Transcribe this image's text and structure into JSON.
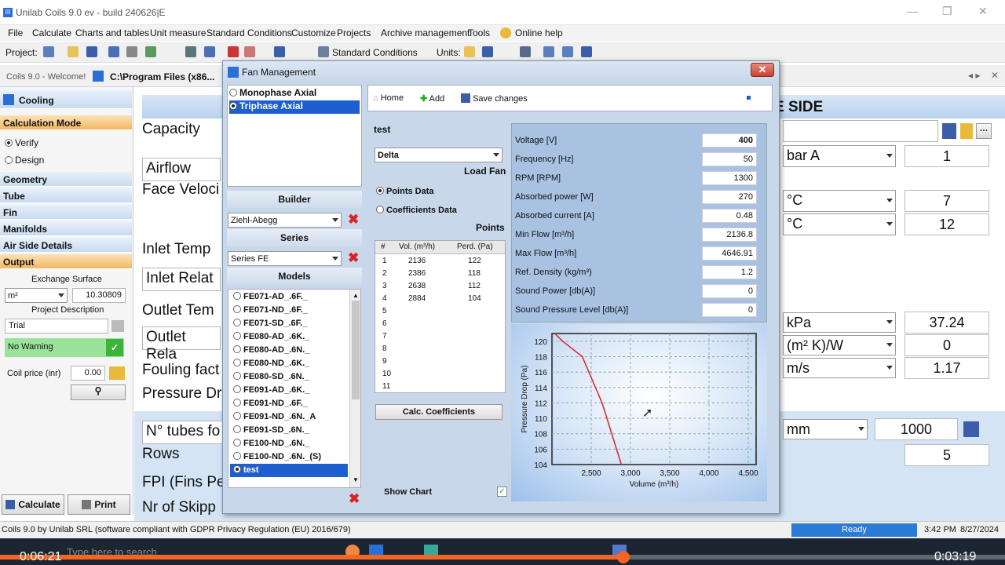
{
  "app": {
    "title": "Unilab Coils 9.0 ev - build 240626|E",
    "logo": "III"
  },
  "menu": [
    "File",
    "Calculate",
    "Charts and tables",
    "Unit measure",
    "Standard Conditions",
    "Customize",
    "Projects",
    "Archive management",
    "Tools",
    "Online help"
  ],
  "toolbar": {
    "project_label": "Project:",
    "std_cond": "Standard Conditions",
    "units_label": "Units:"
  },
  "tabs": {
    "welcome": "Coils 9.0 - Welcome!",
    "path": "C:\\Program Files (x86..."
  },
  "sidebar": {
    "cooling": "Cooling",
    "calc_mode": "Calculation Mode",
    "verify": "Verify",
    "design": "Design",
    "geometry": "Geometry",
    "tube": "Tube",
    "fin": "Fin",
    "manifolds": "Manifolds",
    "air_side": "Air Side Details",
    "output": "Output",
    "exchange_surface": "Exchange Surface",
    "unit": "m²",
    "surface_value": "10.30809",
    "project_desc": "Project Description",
    "trial": "Trial",
    "warning": "No Warning",
    "coil_price_label": "Coil price (inr)",
    "coil_price": "0.00",
    "calculate": "Calculate",
    "print": "Print"
  },
  "main": {
    "capacity": "Capacity",
    "airflow": "Airflow",
    "face_velocity": "Face Veloci",
    "inlet_temp": "Inlet Temp",
    "inlet_rel": "Inlet Relat",
    "outlet_temp": "Outlet Tem",
    "outlet_rel": "Outlet Rela",
    "fouling": "Fouling fact",
    "pressure_drop": "Pressure Dr",
    "n_tubes": "N° tubes fo",
    "rows": "Rows",
    "fpi": "FPI (Fins Pe",
    "nr_skipped": "Nr of Skipp",
    "side_title": "E SIDE"
  },
  "right": {
    "r1_unit": "bar A",
    "r1_val": "1",
    "r2_unit": "°C",
    "r2_val": "7",
    "r3_unit": "°C",
    "r3_val": "12",
    "r4_unit": "kPa",
    "r4_val": "37.24",
    "r5_unit": "(m² K)/W",
    "r5_val": "0",
    "r6_unit": "m/s",
    "r6_val": "1.17",
    "r7_unit": "mm",
    "r7_val": "1000",
    "r8_val": "5"
  },
  "dialog": {
    "title": "Fan Management",
    "types": [
      "Monophase Axial",
      "Triphase Axial"
    ],
    "builder_hdr": "Builder",
    "builder": "Ziehl-Abegg",
    "series_hdr": "Series",
    "series": "Series FE",
    "models_hdr": "Models",
    "models": [
      "FE071-AD_.6F._",
      "FE071-ND_.6F._",
      "FE071-SD_.6F._",
      "FE080-AD_.6K._",
      "FE080-AD_.6N._",
      "FE080-ND_.6K._",
      "FE080-SD_.6N._",
      "FE091-AD_.6K._",
      "FE091-ND_.6F._",
      "FE091-ND_.6N._A",
      "FE091-SD_.6N._",
      "FE100-ND_.6N._",
      "FE100-ND_.6N._(S)",
      "test"
    ],
    "home": "Home",
    "add": "Add",
    "save": "Save changes",
    "fan_name": "test",
    "connection": "Delta",
    "load_fan": "Load Fan",
    "points_data": "Points Data",
    "coeff_data": "Coefficients Data",
    "points_hdr": "Points",
    "col_num": "#",
    "col_vol": "Vol. (m³/h)",
    "col_perd": "Perd. (Pa)",
    "rows": [
      [
        "1",
        "2136",
        "122"
      ],
      [
        "2",
        "2386",
        "118"
      ],
      [
        "3",
        "2638",
        "112"
      ],
      [
        "4",
        "2884",
        "104"
      ],
      [
        "5",
        "",
        ""
      ],
      [
        "6",
        "",
        ""
      ],
      [
        "7",
        "",
        ""
      ],
      [
        "8",
        "",
        ""
      ],
      [
        "9",
        "",
        ""
      ],
      [
        "10",
        "",
        ""
      ],
      [
        "11",
        "",
        ""
      ]
    ],
    "calc_coeff": "Calc. Coefficients",
    "show_chart": "Show Chart",
    "props": [
      [
        "Voltage [V]",
        "400"
      ],
      [
        "Frequency [Hz]",
        "50"
      ],
      [
        "RPM [RPM]",
        "1300"
      ],
      [
        "Absorbed power [W]",
        "270"
      ],
      [
        "Absorbed current [A]",
        "0.48"
      ],
      [
        "Min Flow [m³/h]",
        "2136.8"
      ],
      [
        "Max Flow [m³/h]",
        "4646.91"
      ],
      [
        "Ref. Density (kg/m³)",
        "1.2"
      ],
      [
        "Sound Power [db(A)]",
        "0"
      ],
      [
        "Sound Pressure Level [db(A)]",
        "0"
      ]
    ]
  },
  "chart_data": {
    "type": "line",
    "xlabel": "Volume (m³/h)",
    "ylabel": "Pressure Drop (Pa)",
    "xlim": [
      2000,
      4600
    ],
    "ylim": [
      104,
      121
    ],
    "xticks": [
      "2,500",
      "3,000",
      "3,500",
      "4,000",
      "4,500"
    ],
    "yticks": [
      "104",
      "106",
      "108",
      "110",
      "112",
      "114",
      "116",
      "118",
      "120"
    ],
    "series": [
      {
        "x": [
          2036,
          2136,
          2386,
          2638,
          2884
        ],
        "y": [
          121,
          120,
          118,
          112,
          104
        ]
      }
    ],
    "grid": true
  },
  "status": {
    "left": "Coils 9.0 by Unilab SRL (software compliant with GDPR Privacy Regulation (EU) 2016/679)",
    "ready": "Ready",
    "time": "3:42 PM",
    "date": "8/27/2024"
  },
  "video": {
    "elapsed": "0:06:21",
    "remaining": "0:03:19",
    "progress": 0.62,
    "search": "Type here to search"
  }
}
